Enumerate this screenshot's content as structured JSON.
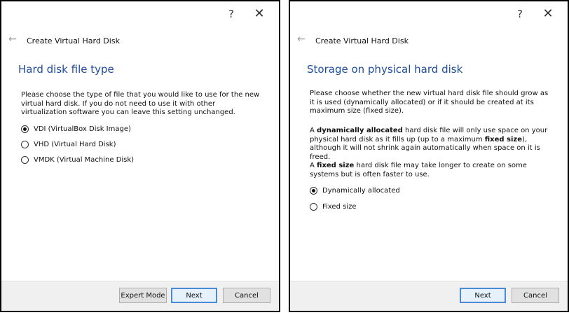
{
  "left_dialog": {
    "help_label": "?",
    "close_label": "✕",
    "back_icon": "←",
    "header_title": "Create Virtual Hard Disk",
    "page_title": "Hard disk file type",
    "description": "Please choose the type of file that you would like to use for the new virtual hard disk. If you do not need to use it with other virtualization software you can leave this setting unchanged.",
    "options": [
      {
        "label": "VDI (VirtualBox Disk Image)",
        "checked": true
      },
      {
        "label": "VHD (Virtual Hard Disk)",
        "checked": false
      },
      {
        "label": "VMDK (Virtual Machine Disk)",
        "checked": false
      }
    ],
    "buttons": {
      "expert": "Expert Mode",
      "next": "Next",
      "cancel": "Cancel"
    }
  },
  "right_dialog": {
    "help_label": "?",
    "close_label": "✕",
    "back_icon": "←",
    "header_title": "Create Virtual Hard Disk",
    "page_title": "Storage on physical hard disk",
    "description": "Please choose whether the new virtual hard disk file should grow as it is used (dynamically allocated) or if it should be created at its maximum size (fixed size).",
    "dynamic_para": {
      "prefix": "A ",
      "bold1": "dynamically allocated",
      "mid": " hard disk file will only use space on your physical hard disk as it fills up (up to a maximum ",
      "bold2": "fixed size",
      "suffix": "), although it will not shrink again automatically when space on it is freed."
    },
    "fixed_para": {
      "prefix": "A ",
      "bold1": "fixed size",
      "suffix": " hard disk file may take longer to create on some systems but is often faster to use."
    },
    "options": [
      {
        "label": "Dynamically allocated",
        "checked": true
      },
      {
        "label": "Fixed size",
        "checked": false
      }
    ],
    "buttons": {
      "next": "Next",
      "cancel": "Cancel"
    }
  },
  "colors": {
    "title_blue": "#1e4b9c",
    "footer_bg": "#f0f0f0",
    "default_button_border": "#4a8ad4"
  }
}
